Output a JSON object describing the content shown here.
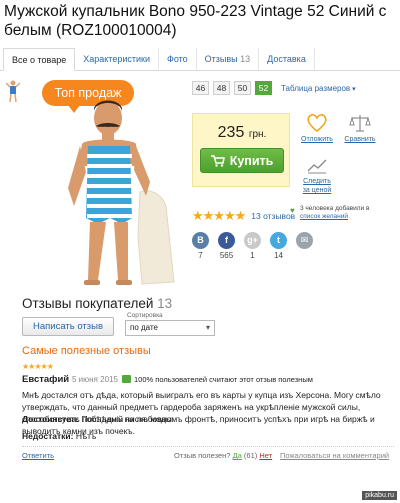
{
  "product": {
    "title": "Мужской купальник Bono 950-223 Vintage 52 Синий с белым (ROZ100010004)"
  },
  "tabs": [
    {
      "label": "Все о товаре",
      "count": ""
    },
    {
      "label": "Характеристики",
      "count": ""
    },
    {
      "label": "Фото",
      "count": ""
    },
    {
      "label": "Отзывы",
      "count": "13"
    },
    {
      "label": "Доставка",
      "count": ""
    }
  ],
  "badge": {
    "text": "Топ продаж"
  },
  "sizes": {
    "options": [
      "46",
      "48",
      "50",
      "52"
    ],
    "selected": "52",
    "table_link": "Таблица размеров"
  },
  "price": {
    "value": "235",
    "currency": "грн."
  },
  "buy_button": {
    "label": "Купить"
  },
  "actions": {
    "wishlist": "Отложить",
    "compare": "Сравнить",
    "price_track": "Следить за ценой"
  },
  "rating": {
    "stars": 5,
    "reviews_link": "13 отзывов"
  },
  "wishlist_note": {
    "text": "3 человека добавили в",
    "link": "список желаний"
  },
  "social": [
    {
      "name": "vk",
      "glyph": "В",
      "color": "#5a7fa6",
      "count": "7"
    },
    {
      "name": "facebook",
      "glyph": "f",
      "color": "#3b5a9a",
      "count": "565"
    },
    {
      "name": "google-plus",
      "glyph": "g+",
      "color": "#c9c9c9",
      "count": "1"
    },
    {
      "name": "twitter",
      "glyph": "t",
      "color": "#45a9e0",
      "count": "14"
    },
    {
      "name": "email",
      "glyph": "✉",
      "color": "#9aa4ad",
      "count": ""
    }
  ],
  "reviews": {
    "title": "Отзывы покупателей",
    "count": "13",
    "write_button": "Написать отзыв",
    "sort_label": "Сортировка",
    "sort_value": "по дате",
    "useful_heading": "Самые полезные отзывы"
  },
  "review": {
    "stars": 5,
    "author": "Евстафий",
    "date": "5 июня 2015",
    "percent_text": "100% пользователей считают этот отзыв полезным",
    "text": "Мнѣ достался отъ дѣда, который выигралъ его въ карты у купца изъ Херсона. Могу смѣло утверждать, что данный предметъ гардероба заряженъ на укрѣпленіе мужской силы, способствуетъ побѣдамъ на любовномъ фронтѣ, приноситъ успѣхъ при игрѣ на биржѣ и выводитъ камни изъ почекъ.",
    "advantages_label": "Достоинства:",
    "advantages": "Послѣдній пискъ моды",
    "disadvantages_label": "Недостатки:",
    "disadvantages": "Нѣтъ",
    "answer_link": "Ответить",
    "useful_question": "Отзыв полезен?",
    "yes_label": "Да",
    "yes_count": "(61)",
    "no_label": "Нет",
    "complain_link": "Пожаловаться на комментарий"
  },
  "watermark": "pikabu.ru"
}
